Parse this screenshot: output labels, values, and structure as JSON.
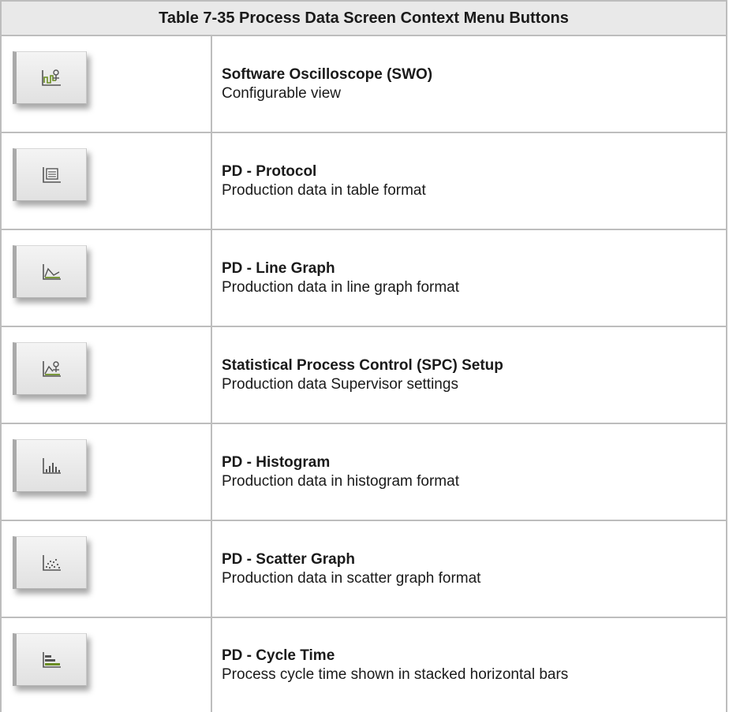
{
  "table": {
    "caption": "Table 7-35 Process Data Screen Context Menu Buttons",
    "rows": [
      {
        "icon": "oscilloscope-icon",
        "title": "Software Oscilloscope (SWO)",
        "description": "Configurable view"
      },
      {
        "icon": "protocol-table-icon",
        "title": "PD - Protocol",
        "description": "Production data in table format"
      },
      {
        "icon": "line-graph-icon",
        "title": "PD - Line Graph",
        "description": "Production data in line graph format"
      },
      {
        "icon": "spc-setup-icon",
        "title": "Statistical Process Control (SPC) Setup",
        "description": "Production data Supervisor settings"
      },
      {
        "icon": "histogram-icon",
        "title": "PD - Histogram",
        "description": "Production data in histogram format"
      },
      {
        "icon": "scatter-graph-icon",
        "title": "PD - Scatter Graph",
        "description": "Production data in scatter graph format"
      },
      {
        "icon": "cycle-time-icon",
        "title": "PD - Cycle Time",
        "description": "Process cycle time shown in stacked horizontal bars"
      }
    ]
  }
}
